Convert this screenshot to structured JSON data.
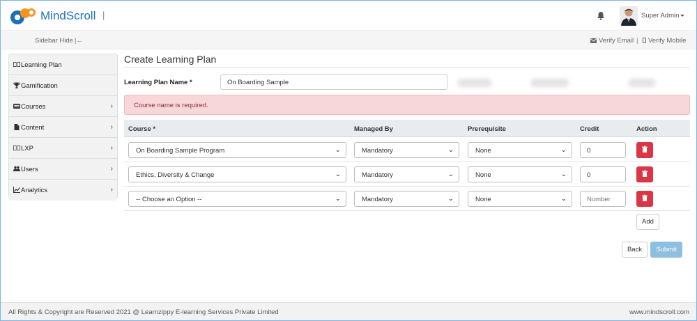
{
  "brand": {
    "name": "MindScroll",
    "separator": "|"
  },
  "header": {
    "user_name": "Super Admin"
  },
  "subbar": {
    "sidebar_hide": "Sidebar Hide",
    "sidebar_hide_icon": "|←",
    "verify_email": "Verify Email",
    "separator": "|",
    "verify_mobile": "Verify Mobile"
  },
  "sidebar": {
    "items": [
      {
        "label": "Learning Plan",
        "icon": "book-icon",
        "chevron": ""
      },
      {
        "label": "Gamification",
        "icon": "trophy-icon",
        "chevron": ""
      },
      {
        "label": "Courses",
        "icon": "courses-icon",
        "chevron": "›"
      },
      {
        "label": "Content",
        "icon": "file-icon",
        "chevron": "›"
      },
      {
        "label": "LXP",
        "icon": "book-icon",
        "chevron": "›"
      },
      {
        "label": "Users",
        "icon": "users-icon",
        "chevron": "›"
      },
      {
        "label": "Analytics",
        "icon": "chart-icon",
        "chevron": "›"
      }
    ]
  },
  "main": {
    "title": "Create Learning Plan",
    "plan_name_label": "Learning Plan Name *",
    "plan_name_value": "On Boarding Sample",
    "alert": "Course name is required.",
    "columns": [
      "Course *",
      "Managed By",
      "Prerequisite",
      "Credit",
      "Action"
    ],
    "rows": [
      {
        "course": "On Boarding Sample Program",
        "managed_by": "Mandatory",
        "prerequisite": "None",
        "credit": "0"
      },
      {
        "course": "Ethics, Diversity & Change",
        "managed_by": "Mandatory",
        "prerequisite": "None",
        "credit": "0"
      },
      {
        "course": "-- Choose an Option --",
        "managed_by": "Mandatory",
        "prerequisite": "None",
        "credit_placeholder": "Number"
      }
    ],
    "add_label": "Add",
    "back_label": "Back",
    "submit_label": "Submit"
  },
  "footer": {
    "copyright": "All Rights & Copyright are Reserved 2021 @ Learnzippy E-learning Services Private Limited",
    "website": "www.mindscroll.com"
  },
  "colors": {
    "brand": "#1f6fb8",
    "danger": "#dc3545",
    "alert_bg": "#f8d7da",
    "submit_disabled": "#8fbfe0"
  }
}
